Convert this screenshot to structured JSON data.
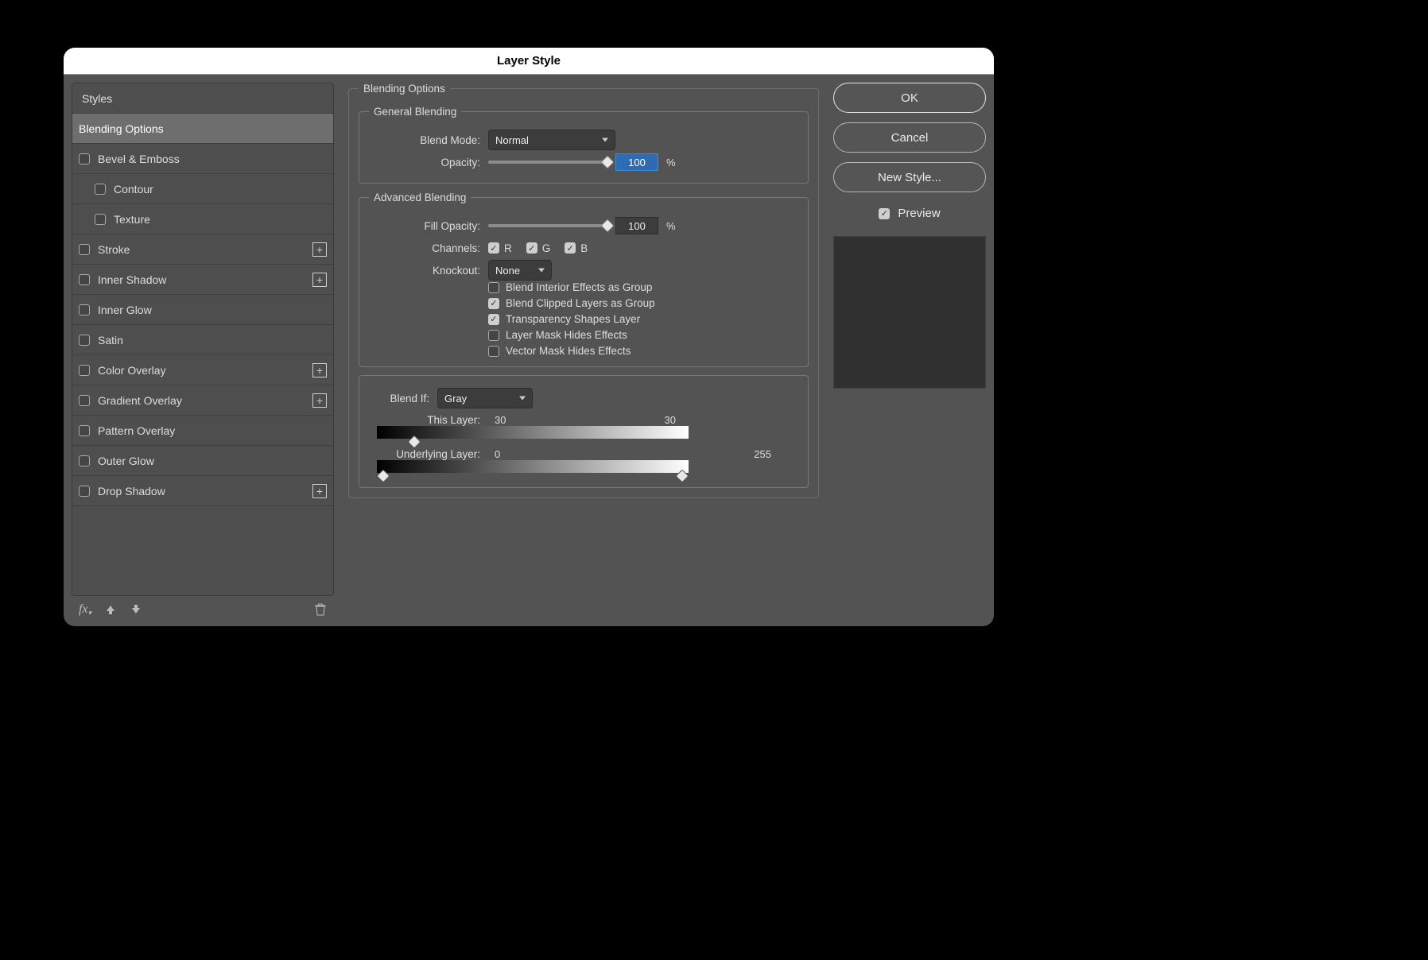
{
  "title": "Layer Style",
  "sidebar": {
    "header": "Styles",
    "items": [
      {
        "label": "Blending Options",
        "active": true
      },
      {
        "label": "Bevel & Emboss",
        "checkbox": true
      },
      {
        "label": "Contour",
        "checkbox": true,
        "indent": true
      },
      {
        "label": "Texture",
        "checkbox": true,
        "indent": true
      },
      {
        "label": "Stroke",
        "checkbox": true,
        "plus": true
      },
      {
        "label": "Inner Shadow",
        "checkbox": true,
        "plus": true
      },
      {
        "label": "Inner Glow",
        "checkbox": true
      },
      {
        "label": "Satin",
        "checkbox": true
      },
      {
        "label": "Color Overlay",
        "checkbox": true,
        "plus": true
      },
      {
        "label": "Gradient Overlay",
        "checkbox": true,
        "plus": true
      },
      {
        "label": "Pattern Overlay",
        "checkbox": true
      },
      {
        "label": "Outer Glow",
        "checkbox": true
      },
      {
        "label": "Drop Shadow",
        "checkbox": true,
        "plus": true
      }
    ]
  },
  "main": {
    "blending_options_title": "Blending Options",
    "general": {
      "title": "General Blending",
      "blend_mode_label": "Blend Mode:",
      "blend_mode_value": "Normal",
      "opacity_label": "Opacity:",
      "opacity_value": "100",
      "pct": "%"
    },
    "advanced": {
      "title": "Advanced Blending",
      "fill_opacity_label": "Fill Opacity:",
      "fill_opacity_value": "100",
      "channels_label": "Channels:",
      "ch_r": "R",
      "ch_g": "G",
      "ch_b": "B",
      "knockout_label": "Knockout:",
      "knockout_value": "None",
      "opt_interior": "Blend Interior Effects as Group",
      "opt_clipped": "Blend Clipped Layers as Group",
      "opt_shapes": "Transparency Shapes Layer",
      "opt_layermask": "Layer Mask Hides Effects",
      "opt_vectormask": "Vector Mask Hides Effects"
    },
    "blendif": {
      "label": "Blend If:",
      "value": "Gray",
      "this_layer_label": "This Layer:",
      "this_layer_low": "30",
      "this_layer_high": "30",
      "underlying_label": "Underlying Layer:",
      "underlying_low": "0",
      "underlying_high": "255"
    }
  },
  "right": {
    "ok": "OK",
    "cancel": "Cancel",
    "new_style": "New Style...",
    "preview": "Preview"
  }
}
